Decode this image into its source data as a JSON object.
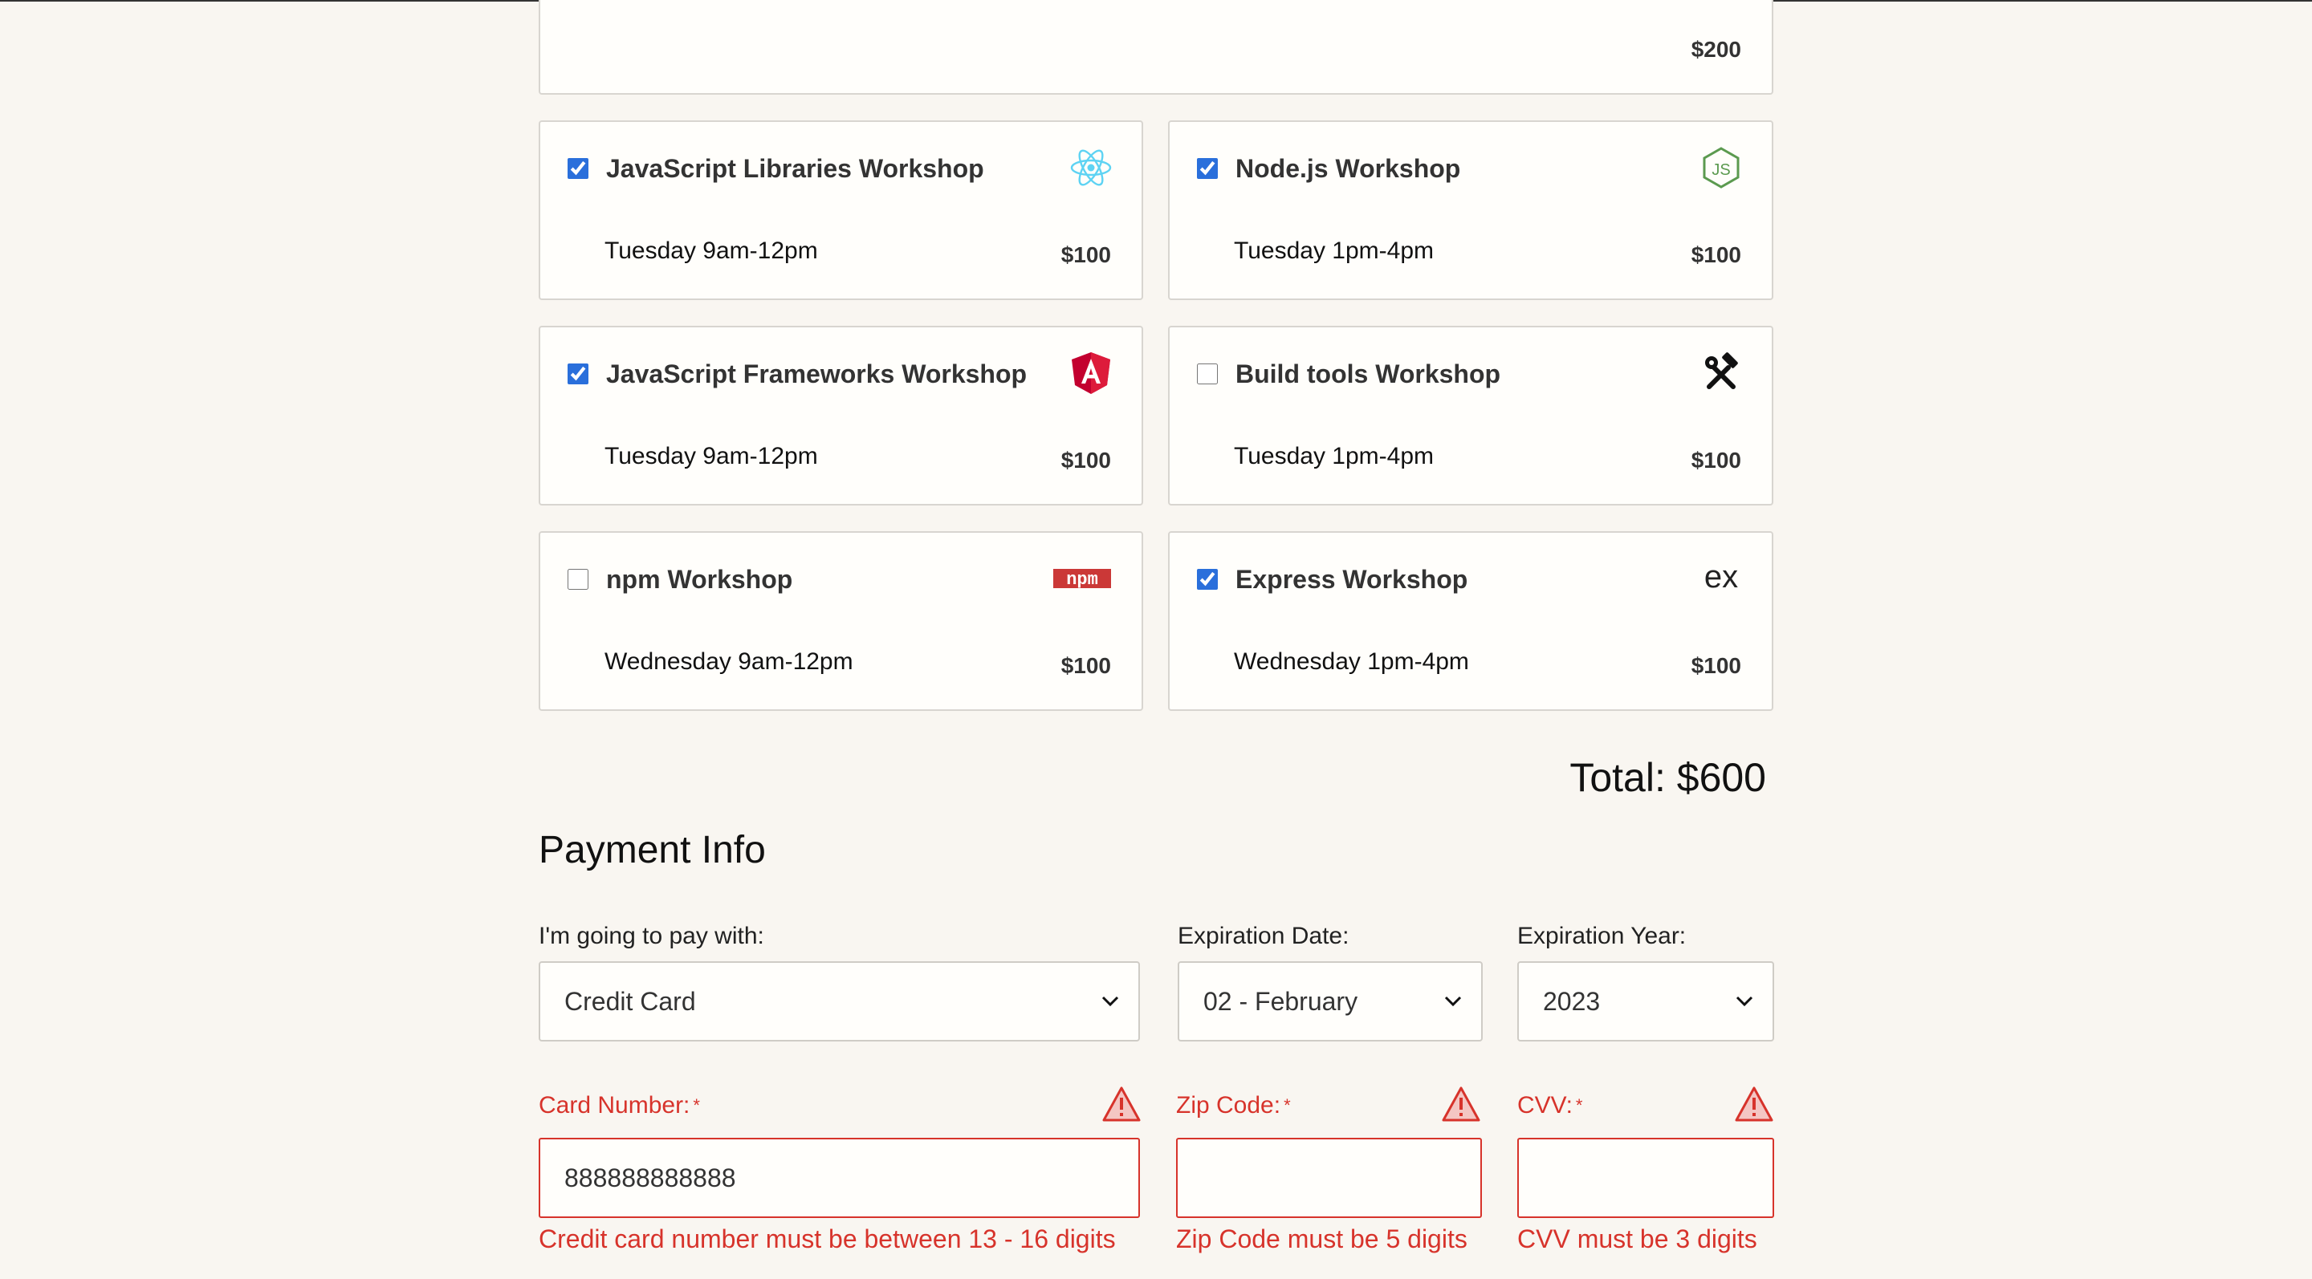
{
  "top_card": {
    "price": "$200"
  },
  "workshops": [
    {
      "title": "JavaScript Libraries Workshop",
      "time": "Tuesday 9am-12pm",
      "price": "$100",
      "checked": true,
      "icon": "react-icon"
    },
    {
      "title": "Node.js Workshop",
      "time": "Tuesday 1pm-4pm",
      "price": "$100",
      "checked": true,
      "icon": "nodejs-icon"
    },
    {
      "title": "JavaScript Frameworks Workshop",
      "time": "Tuesday 9am-12pm",
      "price": "$100",
      "checked": true,
      "icon": "angular-icon"
    },
    {
      "title": "Build tools Workshop",
      "time": "Tuesday 1pm-4pm",
      "price": "$100",
      "checked": false,
      "icon": "hammer-wrench-icon"
    },
    {
      "title": "npm Workshop",
      "time": "Wednesday 9am-12pm",
      "price": "$100",
      "checked": false,
      "icon": "npm-icon",
      "icon_text": "npm"
    },
    {
      "title": "Express Workshop",
      "time": "Wednesday 1pm-4pm",
      "price": "$100",
      "checked": true,
      "icon": "express-icon",
      "icon_text": "ex"
    }
  ],
  "total": "Total: $600",
  "payment": {
    "section_title": "Payment Info",
    "pay_with_label": "I'm going to pay with:",
    "pay_with_value": "Credit Card",
    "exp_date_label": "Expiration Date:",
    "exp_date_value": "02 - February",
    "exp_year_label": "Expiration Year:",
    "exp_year_value": "2023",
    "card_number_label": "Card Number:",
    "card_number_value": "888888888888",
    "card_number_error": "Credit card number must be between 13 - 16 digits",
    "zip_label": "Zip Code:",
    "zip_value": "",
    "zip_error": "Zip Code must be 5 digits",
    "cvv_label": "CVV:",
    "cvv_value": "",
    "cvv_error": "CVV must be 3 digits",
    "required_marker": "*"
  },
  "colors": {
    "error": "#d7332b",
    "checkbox": "#2a6fdb",
    "background": "#f9f6f1"
  }
}
